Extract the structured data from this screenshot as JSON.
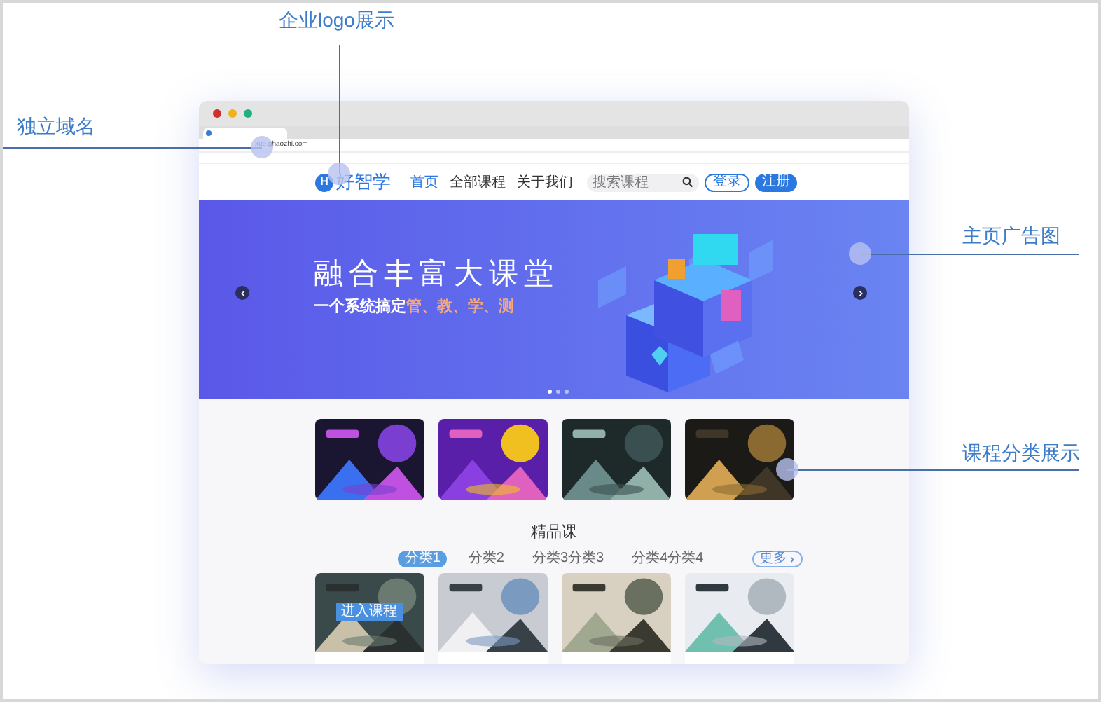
{
  "annotations": [
    {
      "text": "企业logo展示"
    },
    {
      "text": "独立域名"
    },
    {
      "text": "主页广告图"
    },
    {
      "text": "课程分类展示"
    }
  ],
  "browser": {
    "url": "xue.ghaozhi.com"
  },
  "site": {
    "logo_mark": "H",
    "logo": "好智学",
    "nav": [
      {
        "label": "首页",
        "selected": true
      },
      {
        "label": "全部课程",
        "selected": false
      },
      {
        "label": "关于我们",
        "selected": false
      }
    ],
    "search": {
      "placeholder": "搜索课程"
    },
    "login": "登录",
    "register": "注册"
  },
  "banner": {
    "title": "融合丰富大课堂",
    "subtitle_prefix": "一个系统搞定",
    "subtitle_highlight": "管、教、学、测",
    "slides": [
      {
        "selected": true
      },
      {
        "selected": false
      },
      {
        "selected": false
      }
    ]
  },
  "featured": {
    "title": "精品课",
    "tabs": [
      {
        "label": "分类1",
        "selected": true
      },
      {
        "label": "分类2",
        "selected": false
      },
      {
        "label": "分类3分类3",
        "selected": false
      },
      {
        "label": "分类4分类4",
        "selected": false
      }
    ],
    "more": "更多",
    "enter_button": "进入课程"
  }
}
